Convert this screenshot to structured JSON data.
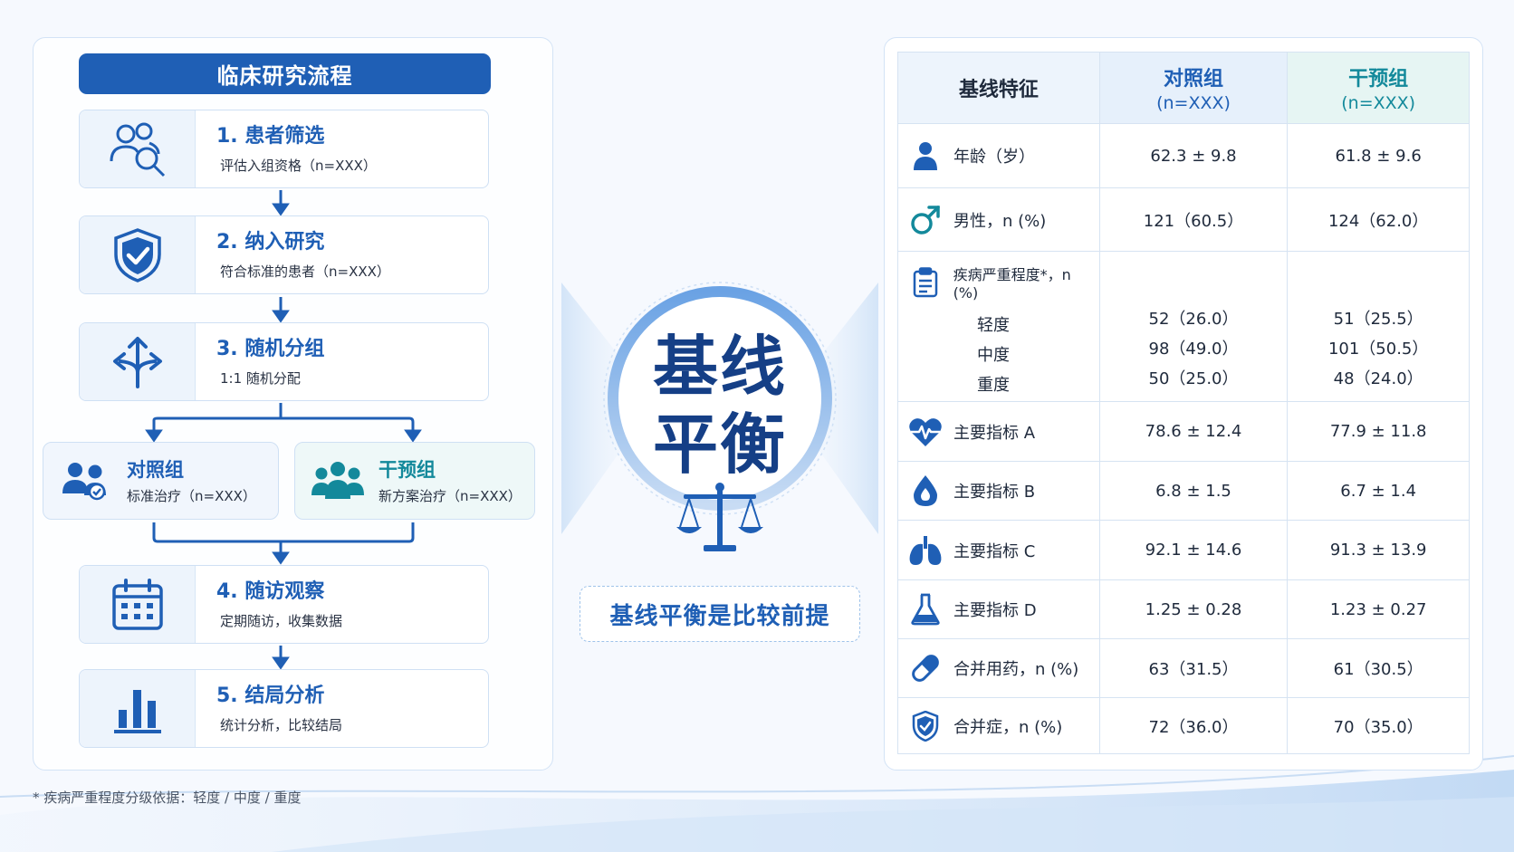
{
  "flow": {
    "title": "临床研究流程",
    "steps": [
      {
        "title": "1. 患者筛选",
        "desc": "评估入组资格（n=XXX）",
        "icon": "people-search-icon"
      },
      {
        "title": "2. 纳入研究",
        "desc": "符合标准的患者（n=XXX）",
        "icon": "shield-check-icon"
      },
      {
        "title": "3. 随机分组",
        "desc": "1:1 随机分配",
        "icon": "split-arrows-icon"
      },
      {
        "title": "4. 随访观察",
        "desc": "定期随访，收集数据",
        "icon": "calendar-icon"
      },
      {
        "title": "5. 结局分析",
        "desc": "统计分析，比较结局",
        "icon": "bar-chart-icon"
      }
    ],
    "groups": {
      "control": {
        "title": "对照组",
        "desc": "标准治疗（n=XXX）"
      },
      "intervention": {
        "title": "干预组",
        "desc": "新方案治疗（n=XXX）"
      }
    }
  },
  "center": {
    "title_line1": "基线",
    "title_line2": "平衡",
    "label": "基线平衡是比较前提"
  },
  "table": {
    "headers": {
      "feature": "基线特征",
      "control": "对照组",
      "control_n": "(n=XXX)",
      "intervention": "干预组",
      "intervention_n": "(n=XXX)"
    },
    "rows": [
      {
        "label": "年龄（岁）",
        "control": "62.3 ± 9.8",
        "intervention": "61.8 ± 9.6",
        "icon": "person-icon"
      },
      {
        "label": "男性，n (%)",
        "control": "121（60.5）",
        "intervention": "124（62.0）",
        "icon": "male-icon"
      },
      {
        "label": "疾病严重程度*，n (%)",
        "icon": "clipboard-icon",
        "sub": [
          {
            "label": "轻度",
            "control": "52（26.0）",
            "intervention": "51（25.5）"
          },
          {
            "label": "中度",
            "control": "98（49.0）",
            "intervention": "101（50.5）"
          },
          {
            "label": "重度",
            "control": "50（25.0）",
            "intervention": "48（24.0）"
          }
        ]
      },
      {
        "label": "主要指标 A",
        "control": "78.6 ± 12.4",
        "intervention": "77.9 ± 11.8",
        "icon": "heartbeat-icon"
      },
      {
        "label": "主要指标 B",
        "control": "6.8 ± 1.5",
        "intervention": "6.7 ± 1.4",
        "icon": "drop-icon"
      },
      {
        "label": "主要指标 C",
        "control": "92.1 ± 14.6",
        "intervention": "91.3 ± 13.9",
        "icon": "lungs-icon"
      },
      {
        "label": "主要指标 D",
        "control": "1.25 ± 0.28",
        "intervention": "1.23 ± 0.27",
        "icon": "flask-icon"
      },
      {
        "label": "合并用药，n (%)",
        "control": "63（31.5）",
        "intervention": "61（30.5）",
        "icon": "pill-icon"
      },
      {
        "label": "合并症，n (%)",
        "control": "72（36.0）",
        "intervention": "70（35.0）",
        "icon": "shield-check-icon"
      }
    ]
  },
  "footnote": "* 疾病严重程度分级依据：轻度 / 中度 / 重度",
  "colors": {
    "primary": "#1f5fb5",
    "teal": "#13899b",
    "dark": "#153f86"
  }
}
